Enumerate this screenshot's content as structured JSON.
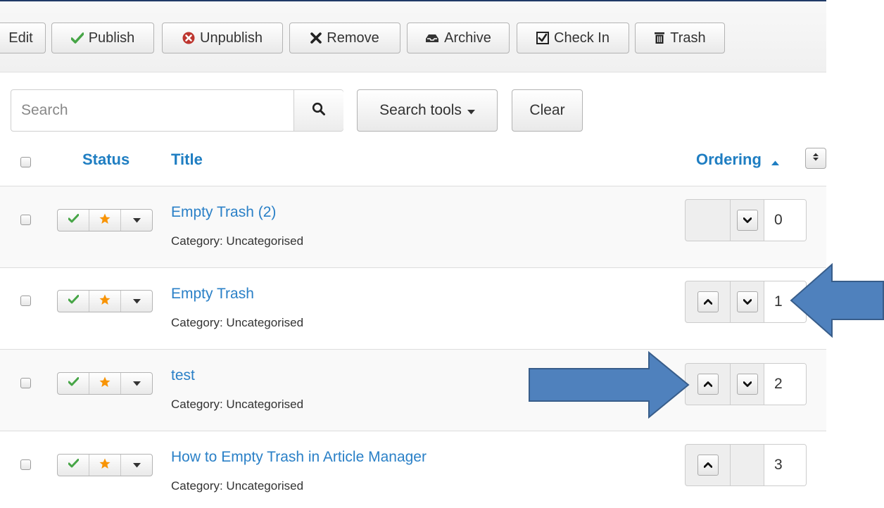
{
  "toolbar": {
    "edit": "Edit",
    "publish": "Publish",
    "unpublish": "Unpublish",
    "remove": "Remove",
    "archive": "Archive",
    "check_in": "Check In",
    "trash": "Trash"
  },
  "search": {
    "placeholder": "Search",
    "tools": "Search tools",
    "clear": "Clear"
  },
  "columns": {
    "status": "Status",
    "title": "Title",
    "ordering": "Ordering"
  },
  "rows": [
    {
      "title": "Empty Trash (2)",
      "category": "Category: Uncategorised",
      "order": "0"
    },
    {
      "title": "Empty Trash",
      "category": "Category: Uncategorised",
      "order": "1"
    },
    {
      "title": "test",
      "category": "Category: Uncategorised",
      "order": "2"
    },
    {
      "title": "How to Empty Trash in Article Manager",
      "category": "Category: Uncategorised",
      "order": "3"
    }
  ],
  "colors": {
    "link": "#2a80c7",
    "published_check": "#46a546",
    "featured_star": "#f89406",
    "annotation_arrow": "#4f81bd"
  }
}
